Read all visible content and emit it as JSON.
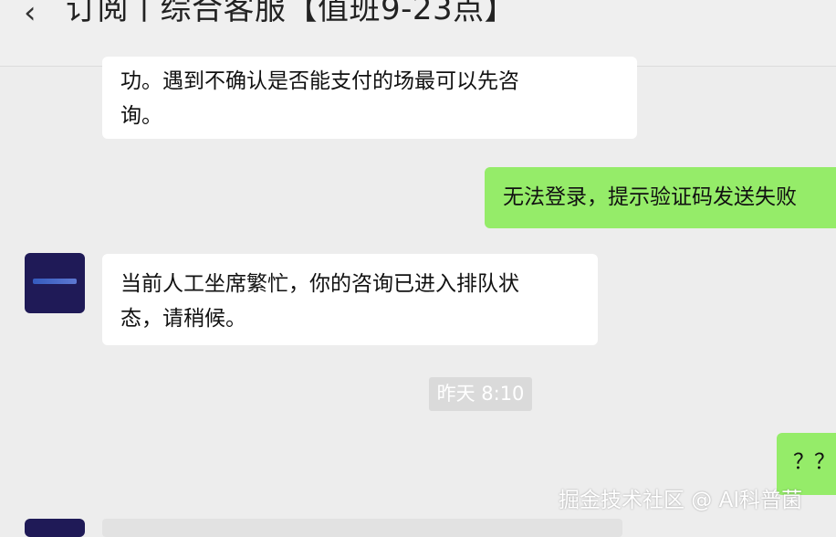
{
  "header": {
    "back_icon": "chevron-left-icon",
    "title": "订阅丨综合客服【值班9-23点】"
  },
  "messages": {
    "m1": {
      "line1": "功。遇到不确认是否能支付的场最可以先咨",
      "line2": "询。"
    },
    "m2": {
      "text": "无法登录，提示验证码发送失败"
    },
    "m3": {
      "line1": "当前人工坐席繁忙，你的咨询已进入排队状",
      "line2": "态，请稍候。"
    },
    "m4": {
      "text": "？？"
    }
  },
  "timestamp": "昨天 8:10",
  "watermark": "掘金技术社区 @ AI科普菌",
  "colors": {
    "outgoing_bubble": "#95ec69",
    "incoming_bubble": "#ffffff",
    "background": "#ededed",
    "avatar": "#1f1a57"
  }
}
